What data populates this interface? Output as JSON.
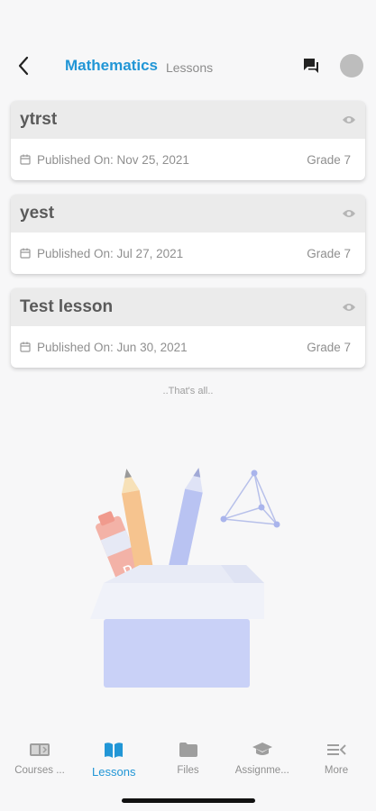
{
  "header": {
    "title": "Mathematics",
    "subtitle": "Lessons"
  },
  "lessons": [
    {
      "title": "ytrst",
      "published": "Published On: Nov 25, 2021",
      "grade": "Grade 7"
    },
    {
      "title": "yest",
      "published": "Published On: Jul 27, 2021",
      "grade": "Grade 7"
    },
    {
      "title": "Test lesson",
      "published": "Published On: Jun 30, 2021",
      "grade": "Grade 7"
    }
  ],
  "end_text": "..That's all..",
  "tabs": [
    {
      "label": "Courses ...",
      "icon": "courses-icon"
    },
    {
      "label": "Lessons",
      "icon": "lessons-book-icon",
      "active": true
    },
    {
      "label": "Files",
      "icon": "folder-icon"
    },
    {
      "label": "Assignme...",
      "icon": "graduation-cap-icon"
    },
    {
      "label": "More",
      "icon": "more-list-icon"
    }
  ],
  "colors": {
    "accent": "#2196d6",
    "muted_text": "#8f8f8f",
    "card_header": "#ebebeb",
    "illustration_box": "#c9d1f7"
  }
}
